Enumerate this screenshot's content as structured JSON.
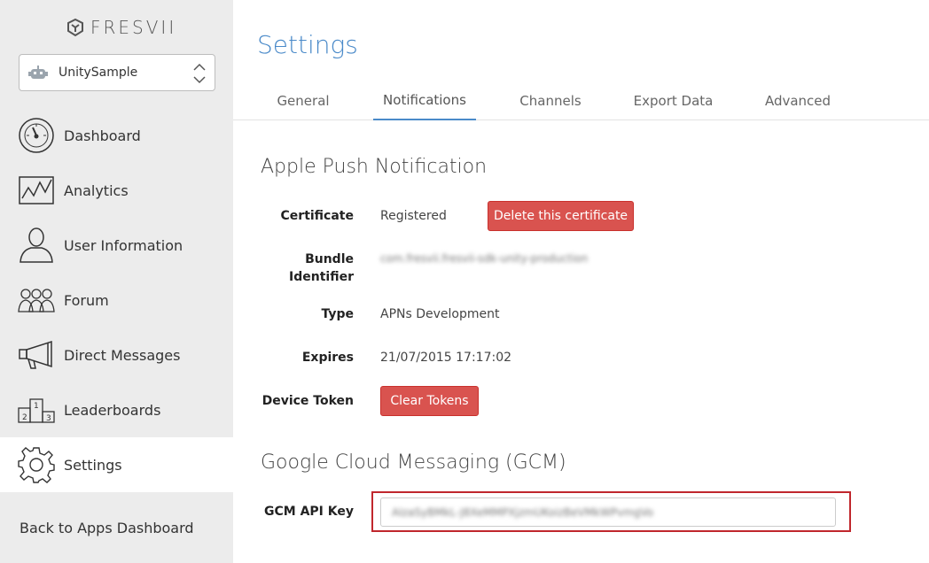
{
  "brand": {
    "logo_text": "FRESVII"
  },
  "app_selector": {
    "selected": "UnitySample"
  },
  "sidebar": {
    "items": [
      {
        "label": "Dashboard",
        "icon": "gauge-icon"
      },
      {
        "label": "Analytics",
        "icon": "line-chart-icon"
      },
      {
        "label": "User Information",
        "icon": "user-icon"
      },
      {
        "label": "Forum",
        "icon": "users-group-icon"
      },
      {
        "label": "Direct Messages",
        "icon": "megaphone-icon"
      },
      {
        "label": "Leaderboards",
        "icon": "podium-icon"
      },
      {
        "label": "Settings",
        "icon": "gear-icon"
      }
    ],
    "active": "Settings",
    "back_link": "Back to Apps Dashboard"
  },
  "main": {
    "title": "Settings",
    "tabs": [
      {
        "label": "General"
      },
      {
        "label": "Notifications"
      },
      {
        "label": "Channels"
      },
      {
        "label": "Export Data"
      },
      {
        "label": "Advanced"
      }
    ],
    "active_tab": "Notifications",
    "apns": {
      "title": "Apple Push Notification",
      "certificate_label": "Certificate",
      "certificate_value": "Registered",
      "delete_button": "Delete this certificate",
      "bundle_label_line1": "Bundle",
      "bundle_label_line2": "Identifier",
      "bundle_value": "com.fresvii.fresvii-sdk-unity-production",
      "type_label": "Type",
      "type_value": "APNs Development",
      "expires_label": "Expires",
      "expires_value": "21/07/2015 17:17:02",
      "device_token_label": "Device Token",
      "clear_tokens_button": "Clear Tokens"
    },
    "gcm": {
      "title": "Google Cloud Messaging (GCM)",
      "api_key_label": "GCM API Key",
      "api_key_value": "AIzaSyBMkL-J8XeMMPXjzmUKoizBeVMkWPvmgVo"
    }
  },
  "colors": {
    "accent": "#4a8ac9",
    "danger": "#d9534f",
    "highlight": "#c0272d",
    "sidebar_bg": "#ececec"
  }
}
